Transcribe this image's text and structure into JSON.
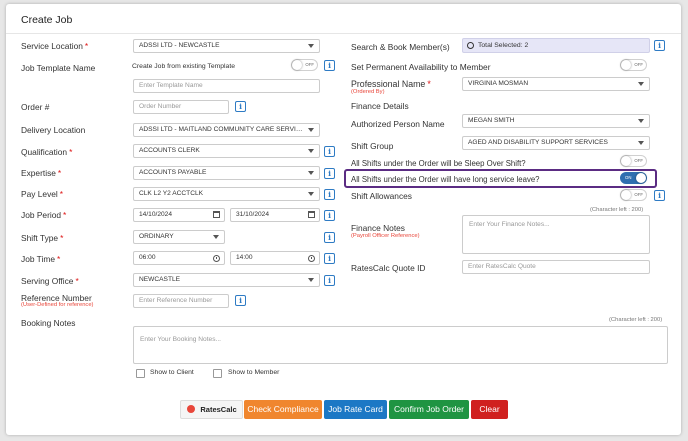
{
  "page": {
    "title": "Create Job"
  },
  "left": {
    "service_location": {
      "label": "Service Location",
      "value": "ADSSI LTD - NEWCASTLE"
    },
    "job_template": {
      "label": "Job Template Name",
      "toggle_text": "Create Job from existing Template",
      "toggle_state": "OFF",
      "placeholder": "Enter Template Name"
    },
    "order_no": {
      "label": "Order #",
      "placeholder": "Order Number"
    },
    "delivery_location": {
      "label": "Delivery Location",
      "value": "ADSSI LTD - MAITLAND COMMUNITY CARE SERVIC..."
    },
    "qualification": {
      "label": "Qualification",
      "value": "ACCOUNTS CLERK"
    },
    "expertise": {
      "label": "Expertise",
      "value": "ACCOUNTS PAYABLE"
    },
    "pay_level": {
      "label": "Pay Level",
      "value": "CLK L2 Y2 ACCTCLK"
    },
    "job_period": {
      "label": "Job Period",
      "start": "14/10/2024",
      "end": "31/10/2024"
    },
    "shift_type": {
      "label": "Shift Type",
      "value": "ORDINARY"
    },
    "job_time": {
      "label": "Job Time",
      "start": "06:00",
      "end": "14:00"
    },
    "serving_office": {
      "label": "Serving Office",
      "value": "NEWCASTLE"
    },
    "reference_number": {
      "label": "Reference Number",
      "sublabel": "(User-Defined for reference)",
      "placeholder": "Enter Reference Number"
    }
  },
  "right": {
    "search_book": {
      "label": "Search & Book Member(s)",
      "value": "Total Selected: 2"
    },
    "set_permanent": {
      "label": "Set Permanent Availability to Member",
      "state": "OFF"
    },
    "professional_name": {
      "label": "Professional Name",
      "sublabel": "(Ordered By)",
      "value": "VIRGINIA MOSMAN"
    },
    "finance_details": {
      "label": "Finance Details"
    },
    "authorized_person": {
      "label": "Authorized Person Name",
      "value": "MEGAN SMITH"
    },
    "shift_group": {
      "label": "Shift Group",
      "value": "AGED AND DISABILITY SUPPORT SERVICES"
    },
    "sleep_over": {
      "label": "All Shifts under the Order will be Sleep Over Shift?",
      "state": "OFF"
    },
    "long_service": {
      "label": "All Shifts under the Order will have long service leave?",
      "state": "ON"
    },
    "shift_allowances": {
      "label": "Shift Allowances",
      "state": "OFF"
    },
    "finance_notes": {
      "label": "Finance Notes",
      "sublabel": "(Payroll Officer Reference)",
      "char_left": "(Character left : 200)",
      "placeholder": "Enter Your Finance Notes..."
    },
    "ratescalc_quote": {
      "label": "RatesCalc Quote ID",
      "placeholder": "Enter RatesCalc Quote"
    }
  },
  "booking": {
    "label": "Booking Notes",
    "char_left": "(Character left : 200)",
    "placeholder": "Enter Your Booking Notes...",
    "show_client": "Show to Client",
    "show_member": "Show to Member"
  },
  "footer": {
    "ratescalc": "RatesCalc",
    "check_compliance": "Check Compliance",
    "job_rate_card": "Job Rate Card",
    "confirm": "Confirm Job Order",
    "clear": "Clear"
  },
  "colors": {
    "accent_blue": "#2e7bc4",
    "highlight_border": "#5b2c83",
    "required": "#d11111",
    "orange": "#f0862e",
    "blue_button": "#1c78c5",
    "green_button": "#1f9442",
    "red_button": "#d0201f",
    "search_box_bg": "#e6e6f7"
  },
  "icons": [
    "info-icon",
    "calendar-icon",
    "clock-icon",
    "search-icon",
    "dropdown-caret-icon",
    "ratescalc-logo-icon"
  ]
}
